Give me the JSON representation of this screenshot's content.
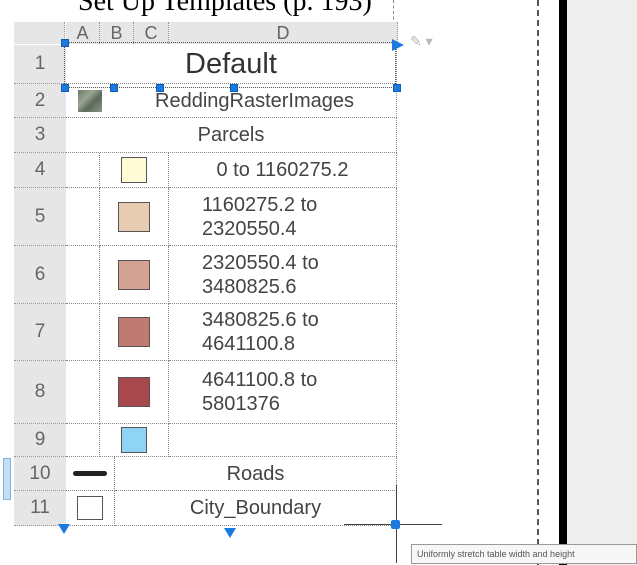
{
  "page_fragment": "Set Up Templates (p. 193)",
  "table": {
    "column_headers": [
      "A",
      "B",
      "C",
      "D"
    ],
    "rows": [
      {
        "num": "1",
        "label": "Default"
      },
      {
        "num": "2",
        "label": "ReddingRasterImages",
        "icon": "raster-image-icon"
      },
      {
        "num": "3",
        "label": "Parcels"
      },
      {
        "num": "4",
        "label": "0 to 1160275.2",
        "swatch": "#fffbd6"
      },
      {
        "num": "5",
        "label_line1": "1160275.2 to",
        "label_line2": "2320550.4",
        "swatch": "#e8ccb2"
      },
      {
        "num": "6",
        "label_line1": "2320550.4 to",
        "label_line2": "3480825.6",
        "swatch": "#d3a292"
      },
      {
        "num": "7",
        "label_line1": "3480825.6 to",
        "label_line2": "4641100.8",
        "swatch": "#c07a72"
      },
      {
        "num": "8",
        "label_line1": "4641100.8 to",
        "label_line2": "5801376",
        "swatch": "#a8474c"
      },
      {
        "num": "9",
        "label": "",
        "swatch": "#8fd4f5"
      },
      {
        "num": "10",
        "label": "Roads",
        "icon": "road-line-icon"
      },
      {
        "num": "11",
        "label": "City_Boundary",
        "icon": "boundary-swatch-icon"
      }
    ]
  },
  "tooltip": "Uniformly stretch table width and height",
  "colors": {
    "grip_blue": "#1a7ae0",
    "header_gray": "#e6e6e6"
  }
}
